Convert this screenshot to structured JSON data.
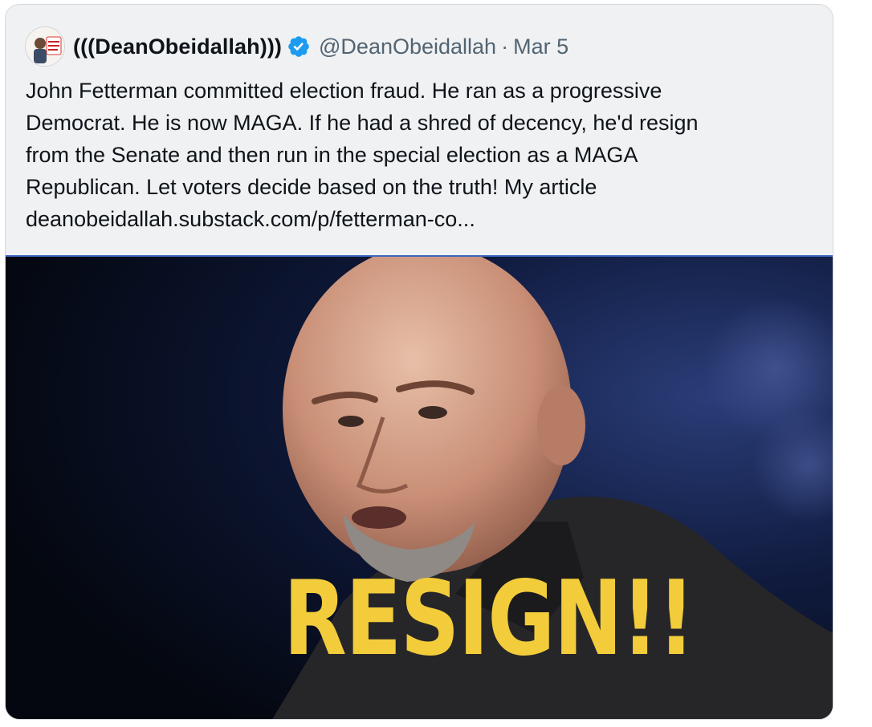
{
  "tweet": {
    "display_name": "(((DeanObeidallah)))",
    "handle": "@DeanObeidallah",
    "separator": "·",
    "date": "Mar 5",
    "text_lines": [
      "John Fetterman committed election fraud. He ran as a progressive",
      "Democrat. He is now MAGA. If he had a shred of decency, he'd resign",
      "from the Senate and then run in the special election as a MAGA",
      "Republican. Let voters decide based on the truth! My article",
      "deanobeidallah.substack.com/p/fetterman-co..."
    ],
    "media": {
      "overlay_text": "RESIGN!!",
      "description_icon": "photo-of-man"
    },
    "avatar_icon": "profile-avatar-icon",
    "verified_icon": "verified-badge-icon"
  },
  "colors": {
    "card_bg": "#eff1f3",
    "text": "#0f1419",
    "muted": "#536471",
    "verified": "#1d9bf0",
    "overlay_text": "#f2cc3b"
  }
}
